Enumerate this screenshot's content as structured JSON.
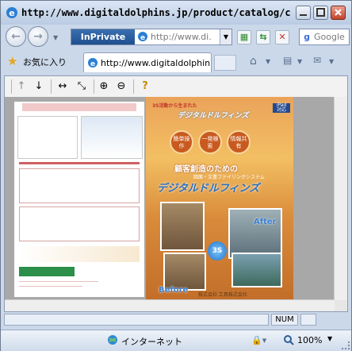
{
  "window": {
    "title": "http://www.digitaldolphins.jp/product/catalog/cat..."
  },
  "navbar": {
    "inprivate_label": "InPrivate",
    "address_text": "http://www.di...",
    "search_text": "Google",
    "icons": [
      "back-icon",
      "forward-icon",
      "compatibility-icon",
      "refresh-icon",
      "stop-icon",
      "google-icon"
    ]
  },
  "favorites": {
    "label": "お気に入り",
    "tab_title": "http://www.digitaldolphin..."
  },
  "toolbar": {
    "icons": [
      "arrow-up-icon",
      "arrow-down-icon",
      "fit-width-icon",
      "fit-page-icon",
      "zoom-in-icon",
      "zoom-out-icon",
      "help-icon"
    ]
  },
  "document": {
    "page1_title": "3S活動から生まれた",
    "cover": {
      "tagline": "3S活動から生まれた",
      "sub_tagline": "図面・文書ファイリングシステム",
      "brand": "デジタルドルフィンズ",
      "badge": "iPad",
      "badge_sub": "対応",
      "hexes": [
        "簡単操作",
        "一発検索",
        "情報共有"
      ],
      "headline": "顧客創造のための",
      "sub": "図面・文書ファイリングシステム",
      "product": "デジタルドルフィンズ",
      "after": "After",
      "before": "Before",
      "center_badge": "3S",
      "company": "株式会社 工具株式会社"
    }
  },
  "status": {
    "num": "NUM",
    "zone": "インターネット",
    "zoom": "100%"
  },
  "colors": {
    "accent": "#2a6fbf",
    "cover_bg": "#eaa35a",
    "inprivate": "#1f4f8e"
  }
}
